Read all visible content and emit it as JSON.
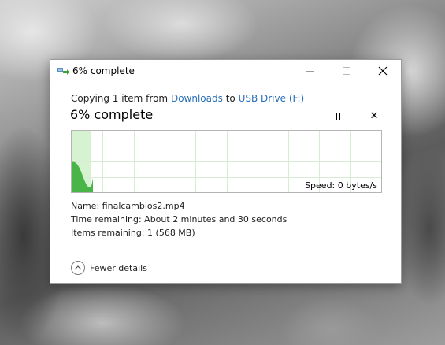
{
  "window": {
    "title": "6% complete",
    "progress_percent": 6
  },
  "copy_info": {
    "prefix": "Copying 1 item from",
    "source": "Downloads",
    "connector": "to",
    "destination": "USB Drive (F:)"
  },
  "status": {
    "heading": "6% complete",
    "speed_label": "Speed: 0 bytes/s"
  },
  "details": {
    "name_label": "Name:",
    "name_value": "finalcambios2.mp4",
    "time_label": "Time remaining:",
    "time_value": "About 2 minutes and 30 seconds",
    "items_label": "Items remaining:",
    "items_value": "1 (568 MB)"
  },
  "footer": {
    "toggle_label": "Fewer details"
  },
  "colors": {
    "link": "#2a6fb7",
    "progress_fill": "#d6f2d0",
    "speed_fill": "#49b548",
    "grid": "#d7ecd3"
  },
  "icons": {
    "app": "file-copy-icon",
    "minimize": "minimize-icon",
    "maximize": "maximize-icon",
    "close": "close-icon",
    "pause": "pause-icon",
    "cancel": "cancel-icon",
    "toggle": "chevron-up-icon"
  }
}
